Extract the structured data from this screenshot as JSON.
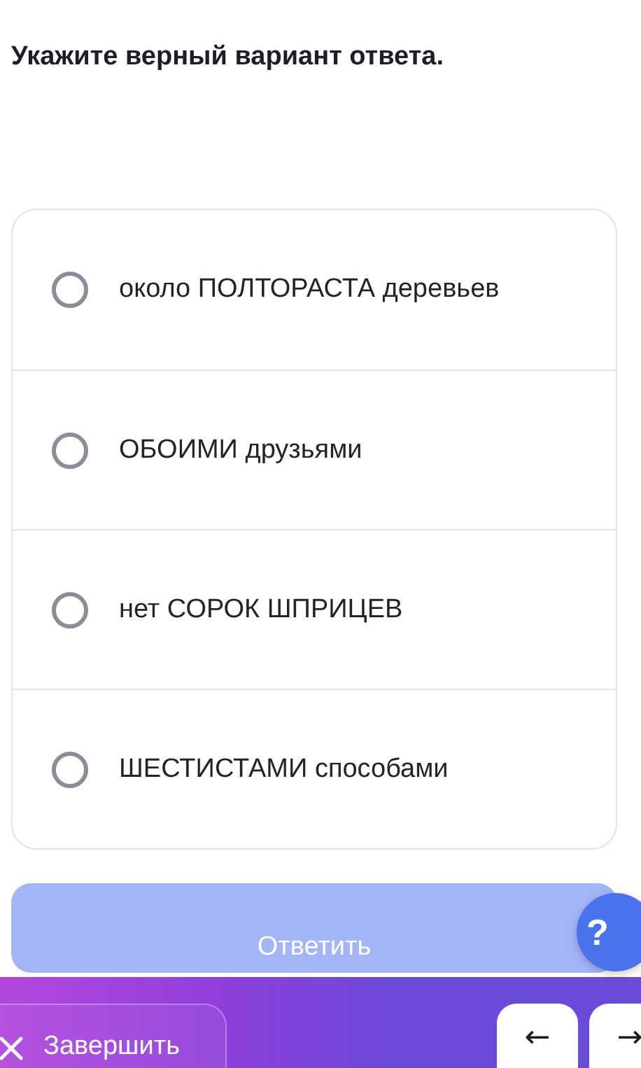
{
  "question": "Укажите верный вариант ответа.",
  "options": [
    {
      "label": "около ПОЛТОРАСТА деревьев",
      "selected": false
    },
    {
      "label": "ОБОИМИ друзьями",
      "selected": false
    },
    {
      "label": "нет СОРОК ШПРИЦЕВ",
      "selected": false
    },
    {
      "label": "ШЕСТИСТАМИ способами",
      "selected": false
    }
  ],
  "help_button": {
    "label": "?"
  },
  "answer_button": {
    "label": "Ответить",
    "disabled": true
  },
  "bottom_bar": {
    "finish_button": {
      "label": "Завершить"
    },
    "prev_button": {
      "label": "←"
    },
    "next_button": {
      "label": "→"
    }
  }
}
